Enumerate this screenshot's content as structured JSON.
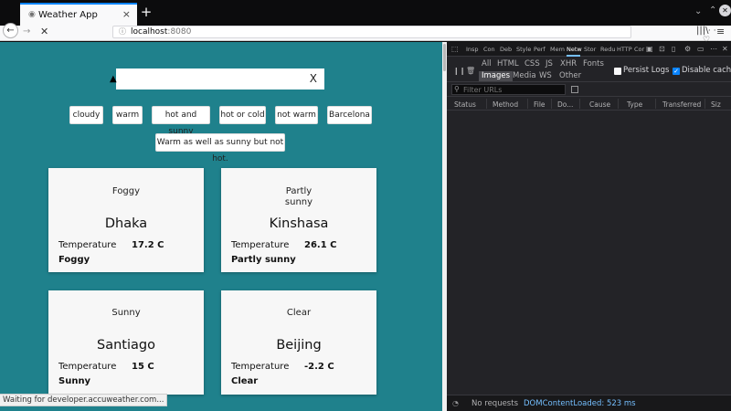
{
  "browser": {
    "tab_title": "Weather App",
    "tab_close": "×",
    "new_tab": "+",
    "url_host": "localhost",
    "url_port": ":8080",
    "status_text": "Waiting for developer.accuweather.com..."
  },
  "search": {
    "value": "",
    "clear_label": "X"
  },
  "chips": [
    "cloudy",
    "warm",
    "hot and sunny",
    "hot or cold",
    "not warm",
    "Barcelona"
  ],
  "long_chip": "Warm as well as sunny but not hot.",
  "cards": [
    {
      "condition": "Foggy",
      "city": "Dhaka",
      "temp_label": "Temperature",
      "temp": "17.2 C",
      "condition_bold": "Foggy"
    },
    {
      "condition": "Partly sunny",
      "city": "Kinshasa",
      "temp_label": "Temperature",
      "temp": "26.1 C",
      "condition_bold": "Partly sunny"
    },
    {
      "condition": "Sunny",
      "city": "Santiago",
      "temp_label": "Temperature",
      "temp": "15 C",
      "condition_bold": "Sunny"
    },
    {
      "condition": "Clear",
      "city": "Beijing",
      "temp_label": "Temperature",
      "temp": "-2.2 C",
      "condition_bold": "Clear"
    }
  ],
  "devtools": {
    "tabs": [
      "Insp",
      "Con",
      "Deb",
      "Style",
      "Perf",
      "Mem",
      "Netw",
      "Stor",
      "Redu",
      "HTTP",
      "Cor"
    ],
    "filters_row1": [
      "All",
      "HTML",
      "CSS",
      "JS",
      "XHR",
      "Fonts"
    ],
    "filters_row2": [
      "Images",
      "Media",
      "WS",
      "Other"
    ],
    "persist_logs": "Persist Logs",
    "disable_cache": "Disable cache",
    "filter_placeholder": "Filter URLs",
    "columns": [
      "Status",
      "Method",
      "File",
      "Do...",
      "Cause",
      "Type",
      "Transferred",
      "Siz"
    ],
    "footer_requests": "No requests",
    "footer_dcl": "DOMContentLoaded: 523 ms"
  },
  "colors": {
    "page_bg": "#1f818c",
    "devtools_bg": "#232327",
    "accent": "#0a84ff"
  }
}
